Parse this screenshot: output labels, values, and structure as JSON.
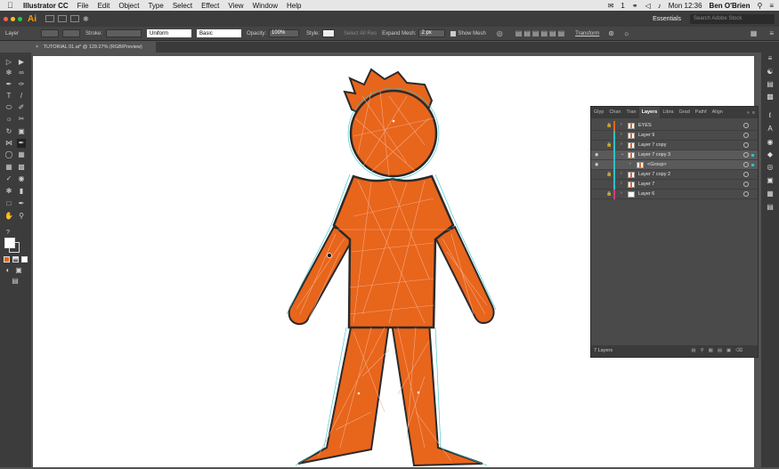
{
  "menubar": {
    "app_name": "Illustrator CC",
    "items": [
      "File",
      "Edit",
      "Object",
      "Type",
      "Select",
      "Effect",
      "View",
      "Window",
      "Help"
    ],
    "clock": "Mon 12:36",
    "user": "Ben O'Brien",
    "notif_count": "1"
  },
  "appbar": {
    "logo": "Ai",
    "workspace": "Essentials",
    "search_placeholder": "Search Adobe Stock"
  },
  "control": {
    "selection_type": "Layer",
    "stroke_label": "Stroke:",
    "stroke_profile": "Uniform",
    "brush": "Basic",
    "opacity_label": "Opacity:",
    "opacity": "100%",
    "style_label": "Style:",
    "select_all_res": "Select All Res",
    "expand_mesh_label": "Expand Mesh:",
    "expand_mesh_value": "2 px",
    "show_mesh": "Show Mesh",
    "transform": "Transform"
  },
  "document": {
    "tab_title": "TUTORIAL 01.ai* @ 129.27% (RGB/Preview)",
    "close": "×"
  },
  "layers_panel": {
    "tabs": [
      "Glyp",
      "Chan",
      "Tran",
      "Layers",
      "Libra",
      "Grad",
      "Pathf",
      "Align"
    ],
    "active_tab": "Layers",
    "rows": [
      {
        "name": "EYES",
        "color": "#e8651c",
        "locked": true,
        "visible": false,
        "indent": 0
      },
      {
        "name": "Layer 9",
        "color": "#2fc0c8",
        "locked": false,
        "visible": false,
        "indent": 0
      },
      {
        "name": "Layer 7 copy",
        "color": "#2fc0c8",
        "locked": true,
        "visible": false,
        "indent": 0
      },
      {
        "name": "Layer 7 copy 3",
        "color": "#2fc0c8",
        "locked": false,
        "visible": true,
        "indent": 0
      },
      {
        "name": "<Group>",
        "color": "#2fc0c8",
        "locked": false,
        "visible": true,
        "indent": 1
      },
      {
        "name": "Layer 7 copy 2",
        "color": "#2fc0c8",
        "locked": true,
        "visible": false,
        "indent": 0
      },
      {
        "name": "Layer 7",
        "color": "#2fc0c8",
        "locked": false,
        "visible": false,
        "indent": 0
      },
      {
        "name": "Layer 6",
        "color": "#d23c7a",
        "locked": true,
        "visible": false,
        "indent": 0
      }
    ],
    "footer": "7 Layers"
  },
  "colors": {
    "figure_fill": "#e8651c",
    "mesh_line": "#f6b08a",
    "outline": "#2a2a2a",
    "selection": "#2fc0c8"
  }
}
